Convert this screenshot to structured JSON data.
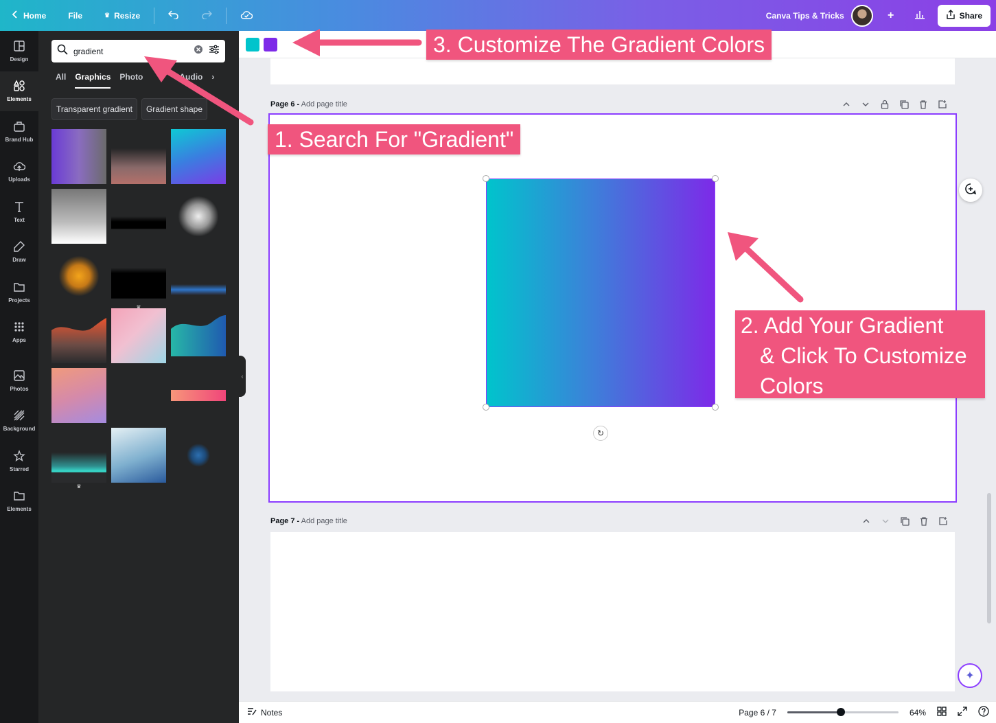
{
  "topbar": {
    "home": "Home",
    "file": "File",
    "resize": "Resize",
    "team_name": "Canva Tips & Tricks",
    "share": "Share"
  },
  "rail": [
    {
      "label": "Design",
      "icon": "layout-icon"
    },
    {
      "label": "Elements",
      "icon": "shapes-icon"
    },
    {
      "label": "Brand Hub",
      "icon": "brand-icon"
    },
    {
      "label": "Uploads",
      "icon": "cloud-upload-icon"
    },
    {
      "label": "Text",
      "icon": "text-icon"
    },
    {
      "label": "Draw",
      "icon": "pen-icon"
    },
    {
      "label": "Projects",
      "icon": "folder-icon"
    },
    {
      "label": "Apps",
      "icon": "apps-icon"
    },
    {
      "label": "Photos",
      "icon": "image-icon"
    },
    {
      "label": "Background",
      "icon": "pattern-icon"
    },
    {
      "label": "Starred",
      "icon": "star-icon"
    },
    {
      "label": "Elements",
      "icon": "folder-icon"
    }
  ],
  "panel": {
    "search_value": "gradient",
    "tabs": [
      "All",
      "Graphics",
      "Photo",
      "Audio"
    ],
    "active_tab": "Graphics",
    "chips": [
      "Transparent gradient",
      "Gradient shape"
    ]
  },
  "toolbar": {
    "colors": [
      "#00c4cc",
      "#7d2ae8"
    ]
  },
  "pages": {
    "page6_label": "Page 6 -",
    "page6_title_placeholder": "Add page title",
    "page7_label": "Page 7 -",
    "page7_title_placeholder": "Add page title"
  },
  "gradient_element": {
    "colors": [
      "#00c4cc",
      "#7d2ae8"
    ]
  },
  "bottombar": {
    "notes": "Notes",
    "page_indicator": "Page 6 / 7",
    "zoom": "64%",
    "zoom_fraction": 0.48
  },
  "callouts": {
    "step1": "1. Search For \"Gradient\"",
    "step2_line1": "2. Add Your Gradient",
    "step2_line2": "& Click To Customize",
    "step2_line3": "Colors",
    "step3": "3. Customize The Gradient Colors"
  },
  "colors": {
    "accent": "#8b3dff",
    "callout": "#f0557e",
    "rail_bg": "#18191b",
    "panel_bg": "#252627"
  }
}
